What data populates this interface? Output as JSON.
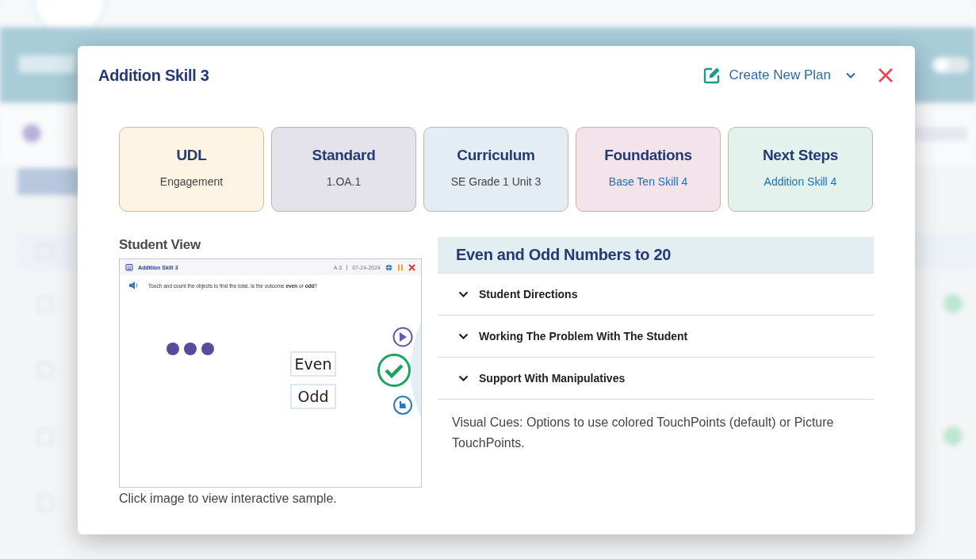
{
  "modal": {
    "title": "Addition Skill 3",
    "create_plan": {
      "label": "Create New Plan"
    }
  },
  "cards": [
    {
      "title": "UDL",
      "value": "Engagement",
      "kind": "text",
      "color": "#fdf4e3"
    },
    {
      "title": "Standard",
      "value": "1.OA.1",
      "kind": "text",
      "color": "#e4e3ec"
    },
    {
      "title": "Curriculum",
      "value": "SE Grade 1 Unit 3",
      "kind": "text",
      "color": "#e4edf3"
    },
    {
      "title": "Foundations",
      "value": "Base Ten Skill 4",
      "kind": "link",
      "color": "#f2e4ea"
    },
    {
      "title": "Next Steps",
      "value": "Addition Skill 4",
      "kind": "link",
      "color": "#e3f2ed"
    }
  ],
  "student_view": {
    "label": "Student View",
    "preview": {
      "title": "Addition Skill 3",
      "code": "A.3",
      "date": "07-24-2024",
      "prompt": "Touch and count the objects to find the total. Is the outcome **even** or **odd**?",
      "choices": [
        {
          "label": "Even",
          "selected": false
        },
        {
          "label": "Odd",
          "selected": false
        }
      ]
    },
    "caption": "Click image to view interactive sample."
  },
  "lesson": {
    "title": "Even and Odd Numbers to 20",
    "sections": [
      {
        "label": "Student Directions",
        "expanded": false
      },
      {
        "label": "Working The Problem With The Student",
        "expanded": false
      },
      {
        "label": "Support With Manipulatives",
        "expanded": false
      }
    ],
    "note": "Visual Cues: Options to use colored TouchPoints (default) or Picture TouchPoints."
  }
}
